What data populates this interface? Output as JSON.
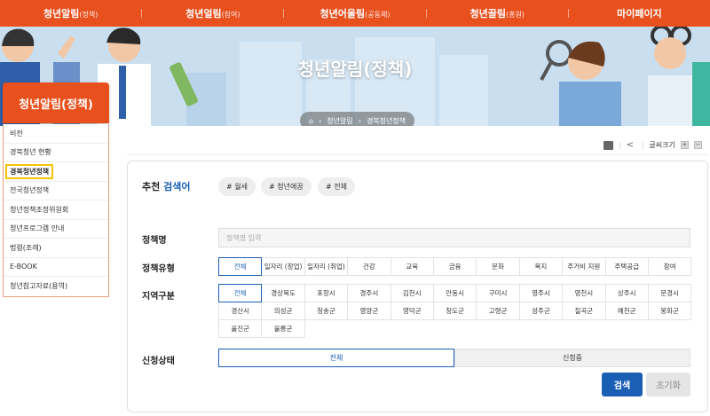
{
  "topnav": {
    "items": [
      {
        "main": "청년알림",
        "sub": "(정책)"
      },
      {
        "main": "청년얼림",
        "sub": "(참여)"
      },
      {
        "main": "청년어울림",
        "sub": "(공동체)"
      },
      {
        "main": "청년끌림",
        "sub": "(흥원)"
      },
      {
        "main": "마이페이지",
        "sub": ""
      }
    ]
  },
  "banner": {
    "title": "청년알림(정책)",
    "breadcrumb": [
      "⌂",
      "청년알림",
      "경북청년정책"
    ]
  },
  "sidebar": {
    "title": "청년알림(정책)",
    "items": [
      "비전",
      "경북청년 현황",
      "경북청년정책",
      "전국청년정책",
      "청년정책조정위원회",
      "청년프로그램 안내",
      "법령(조례)",
      "E-BOOK",
      "청년참고자료(용역)"
    ]
  },
  "util": {
    "font_label": "글씨크기",
    "plus": "+",
    "minus": "−"
  },
  "search": {
    "recommend_label": "추천",
    "recommend_accent": "검색어",
    "tags": [
      "# 월세",
      "# 청년애꿈",
      "# 전체"
    ],
    "policy_name_label": "정책명",
    "policy_name_placeholder": "정책명 입력",
    "policy_type_label": "정책유형",
    "policy_types": [
      "전체",
      "일자리 (창업)",
      "일자리 (취업)",
      "건강",
      "교육",
      "금융",
      "문화",
      "복지",
      "주거비 지원",
      "주택공급",
      "참여"
    ],
    "region_label": "지역구분",
    "regions": [
      "전체",
      "경상북도",
      "포항시",
      "경주시",
      "김천시",
      "안동시",
      "구미시",
      "영주시",
      "영천시",
      "상주시",
      "문경시",
      "경산시",
      "의성군",
      "청송군",
      "영양군",
      "영덕군",
      "청도군",
      "고령군",
      "성주군",
      "칠곡군",
      "예천군",
      "봉화군",
      "울진군",
      "울릉군"
    ],
    "status_label": "신청상태",
    "statuses": [
      "전체",
      "신청중"
    ],
    "search_button": "검색",
    "reset_button": "초기화"
  },
  "colors": {
    "accent": "#e8501e",
    "primary": "#1a5fb4",
    "highlight": "#f5c400"
  }
}
